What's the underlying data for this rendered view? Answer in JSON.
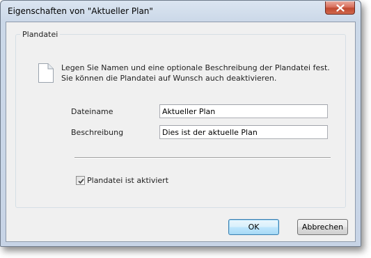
{
  "window": {
    "title": "Eigenschaften von \"Aktueller Plan\""
  },
  "group": {
    "title": "Plandatei",
    "description": "Legen Sie Namen und eine optionale Beschreibung der Plandatei fest. Sie können die Plandatei auf Wunsch auch deaktivieren."
  },
  "fields": {
    "name_label": "Dateiname",
    "name_value": "Aktueller Plan",
    "description_label": "Beschreibung",
    "description_value": "Dies ist der aktuelle Plan"
  },
  "checkbox": {
    "label": "Plandatei ist aktiviert",
    "checked": true
  },
  "buttons": {
    "ok": "OK",
    "cancel": "Abbrechen"
  },
  "icons": [
    "document-icon",
    "close-icon",
    "checkmark-icon"
  ],
  "colors": {
    "close_button": "#c9553e",
    "default_button_border": "#3c7fb1",
    "dialog_background": "#f0f0f0"
  }
}
